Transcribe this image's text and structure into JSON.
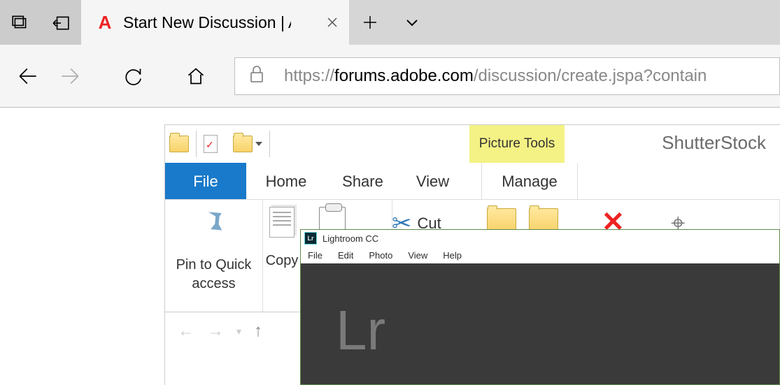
{
  "browser": {
    "tab_title": "Start New Discussion | A",
    "url_prefix": "https://",
    "url_host": "forums.adobe.com",
    "url_path": "/discussion/create.jspa?contain"
  },
  "explorer": {
    "context_tab": "Picture Tools",
    "location": "ShutterStock",
    "tabs": {
      "file": "File",
      "home": "Home",
      "share": "Share",
      "view": "View",
      "manage": "Manage"
    },
    "ribbon": {
      "pin": "Pin to Quick access",
      "copy": "Copy",
      "cut": "Cut"
    }
  },
  "lightroom": {
    "title": "Lightroom CC",
    "menu": {
      "file": "File",
      "edit": "Edit",
      "photo": "Photo",
      "view": "View",
      "help": "Help"
    },
    "logo": "Lr"
  }
}
